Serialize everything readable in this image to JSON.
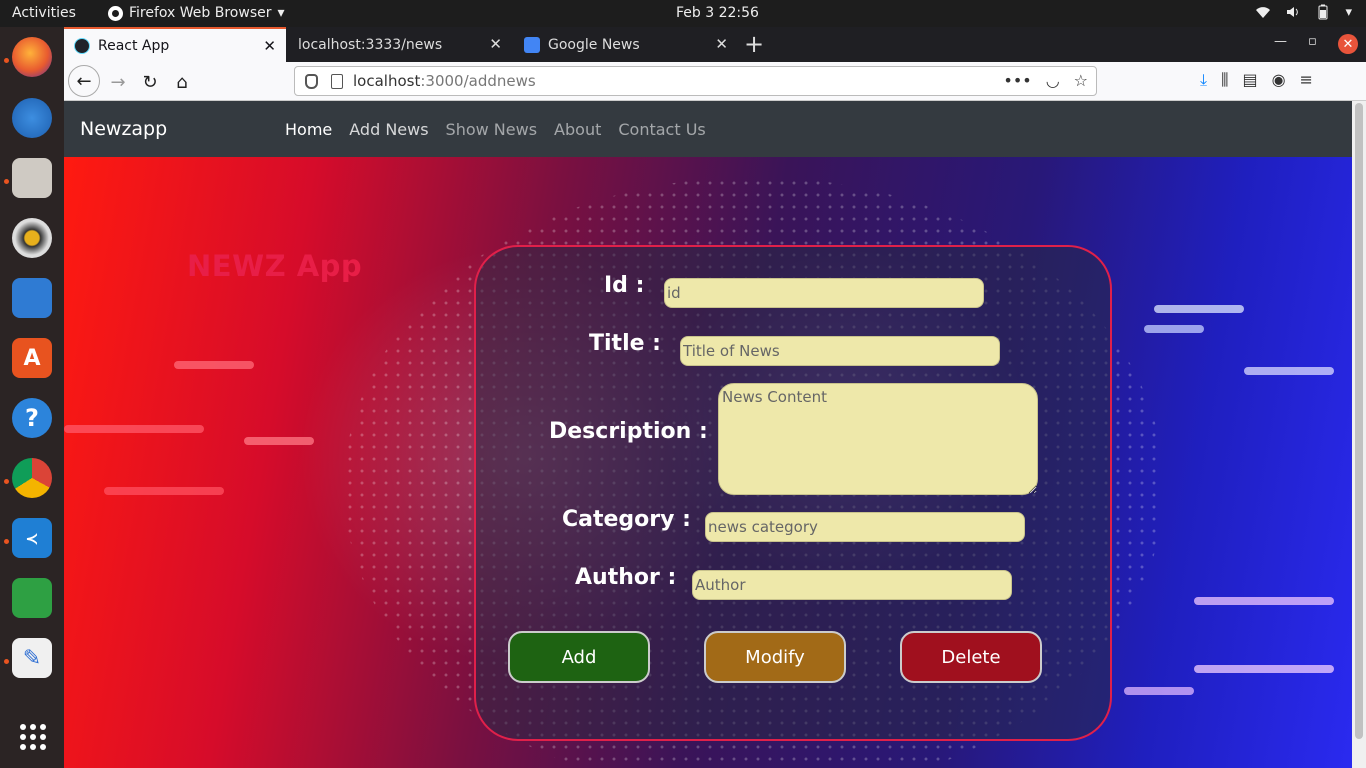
{
  "system": {
    "activities": "Activities",
    "app_menu": "Firefox Web Browser",
    "clock": "Feb 3  22:56"
  },
  "browser": {
    "tabs": [
      {
        "label": "React App",
        "active": true
      },
      {
        "label": "localhost:3333/news",
        "active": false
      },
      {
        "label": "Google News",
        "active": false
      }
    ],
    "url_host": "localhost",
    "url_rest": ":3000/addnews"
  },
  "site": {
    "brand": "Newzapp",
    "nav": [
      "Home",
      "Add News",
      "Show News",
      "About",
      "Contact Us"
    ],
    "app_title": "NEWZ App"
  },
  "form": {
    "id_label": "Id :",
    "id_placeholder": "id",
    "title_label": "Title :",
    "title_placeholder": "Title of News",
    "description_label": "Description :",
    "description_placeholder": "News Content",
    "category_label": "Category :",
    "category_placeholder": "news category",
    "author_label": "Author :",
    "author_placeholder": "Author",
    "add_label": "Add",
    "modify_label": "Modify",
    "delete_label": "Delete"
  },
  "colors": {
    "accent_title": "#e81e47",
    "add_button": "#1e6312",
    "modify_button": "#a26a17",
    "delete_button": "#a0101e",
    "input_bg": "#eee8aa"
  }
}
